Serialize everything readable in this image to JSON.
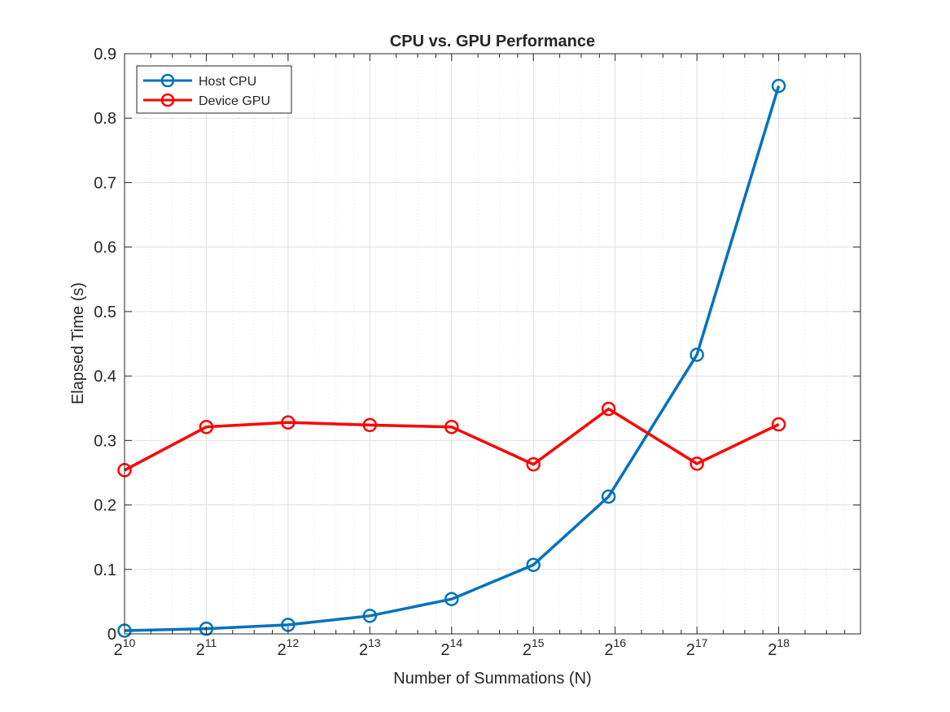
{
  "chart_data": {
    "type": "line",
    "title": "CPU vs. GPU Performance",
    "xlabel": "Number of Summations (N)",
    "ylabel": "Elapsed Time (s)",
    "x_scale": "log2",
    "xlim": [
      1024,
      524288
    ],
    "ylim": [
      0,
      0.9
    ],
    "x_ticks": [
      1024,
      2048,
      4096,
      8192,
      16384,
      32768,
      65536,
      131072,
      262144
    ],
    "x_tick_labels": [
      {
        "base": "2",
        "exp": "10"
      },
      {
        "base": "2",
        "exp": "11"
      },
      {
        "base": "2",
        "exp": "12"
      },
      {
        "base": "2",
        "exp": "13"
      },
      {
        "base": "2",
        "exp": "14"
      },
      {
        "base": "2",
        "exp": "15"
      },
      {
        "base": "2",
        "exp": "16"
      },
      {
        "base": "2",
        "exp": "17"
      },
      {
        "base": "2",
        "exp": "18"
      }
    ],
    "y_ticks": [
      0,
      0.1,
      0.2,
      0.3,
      0.4,
      0.5,
      0.6,
      0.7,
      0.8,
      0.9
    ],
    "y_tick_labels": [
      "0",
      "0.1",
      "0.2",
      "0.3",
      "0.4",
      "0.5",
      "0.6",
      "0.7",
      "0.8",
      "0.9"
    ],
    "grid": true,
    "legend_position": "top-left",
    "x": [
      1024,
      2048,
      4096,
      8192,
      16384,
      32768,
      62000,
      131072,
      262144
    ],
    "series": [
      {
        "name": "Host CPU",
        "color": "#0072BD",
        "values": [
          0.005,
          0.008,
          0.014,
          0.028,
          0.054,
          0.107,
          0.213,
          0.433,
          0.85
        ]
      },
      {
        "name": "Device GPU",
        "color": "#FF0000",
        "values": [
          0.254,
          0.321,
          0.328,
          0.324,
          0.321,
          0.263,
          0.349,
          0.264,
          0.325
        ]
      }
    ]
  }
}
